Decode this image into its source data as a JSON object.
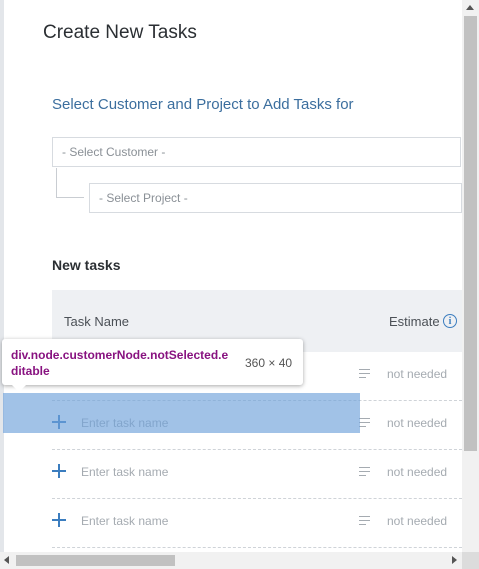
{
  "dialog": {
    "title": "Create New Tasks",
    "subtitle": "Select Customer and Project to Add Tasks for"
  },
  "selectors": {
    "customer_placeholder": "- Select Customer -",
    "project_placeholder": "- Select Project -"
  },
  "tasks_section": {
    "heading": "New tasks",
    "columns": {
      "task_name": "Task Name",
      "estimate": "Estimate"
    },
    "rows": [
      {
        "placeholder": "Enter task name",
        "estimate": "not needed"
      },
      {
        "placeholder": "Enter task name",
        "estimate": "not needed"
      },
      {
        "placeholder": "Enter task name",
        "estimate": "not needed"
      },
      {
        "placeholder": "Enter task name",
        "estimate": "not needed"
      }
    ]
  },
  "inspector": {
    "selector": "div.node.customerNode.notSelected.editable",
    "dimensions": "360 × 40"
  },
  "icons": {
    "close": "close-icon",
    "info": "info-icon",
    "add": "plus-icon",
    "description": "lines-icon"
  },
  "colors": {
    "accent": "#3b7dbf",
    "subtitle": "#3b6e9e",
    "highlight": "#6fa1da",
    "selector_text": "#881280"
  }
}
